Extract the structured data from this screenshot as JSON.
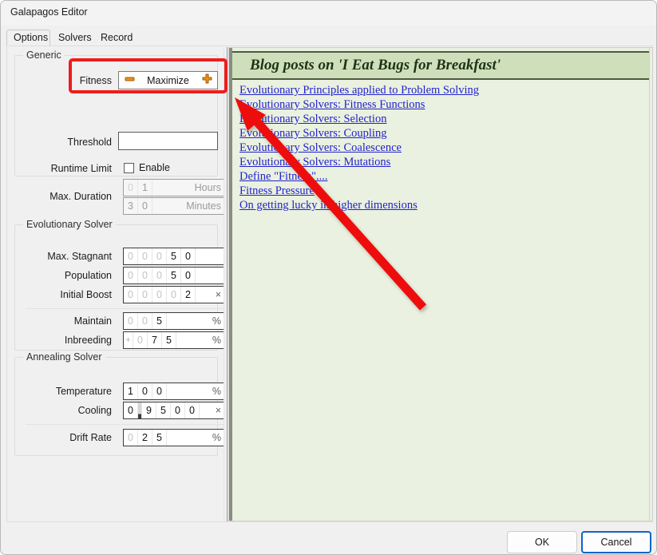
{
  "window": {
    "title": "Galapagos Editor"
  },
  "tabs": [
    {
      "label": "Options",
      "active": true
    },
    {
      "label": "Solvers",
      "active": false
    },
    {
      "label": "Record",
      "active": false
    }
  ],
  "options": {
    "generic": {
      "title": "Generic",
      "fitness": {
        "label": "Fitness",
        "value": "Maximize",
        "decrement_icon": "minus-icon",
        "increment_icon": "plus-icon"
      },
      "threshold": {
        "label": "Threshold",
        "value": ""
      },
      "runtime_limit": {
        "label": "Runtime Limit",
        "checkbox_label": "Enable",
        "checked": false
      },
      "max_duration": {
        "label": "Max. Duration",
        "hours": {
          "digits": [
            "0",
            "1"
          ],
          "leading": 1,
          "unit": "Hours",
          "disabled": true
        },
        "minutes": {
          "digits": [
            "3",
            "0"
          ],
          "leading": 0,
          "unit": "Minutes",
          "disabled": true
        }
      }
    },
    "evolutionary_solver": {
      "title": "Evolutionary Solver",
      "fields": [
        {
          "label": "Max. Stagnant",
          "digits": [
            "0",
            "0",
            "0",
            "5",
            "0"
          ],
          "leading": 3,
          "unit": ""
        },
        {
          "label": "Population",
          "digits": [
            "0",
            "0",
            "0",
            "5",
            "0"
          ],
          "leading": 3,
          "unit": ""
        },
        {
          "label": "Initial Boost",
          "digits": [
            "0",
            "0",
            "0",
            "0",
            "2"
          ],
          "leading": 4,
          "unit": "×"
        },
        {
          "label": "Maintain",
          "digits": [
            "0",
            "0",
            "5"
          ],
          "leading": 2,
          "unit": "%"
        },
        {
          "label": "Inbreeding",
          "sign": "+",
          "digits": [
            "0",
            "7",
            "5"
          ],
          "leading": 1,
          "unit": "%"
        }
      ]
    },
    "annealing_solver": {
      "title": "Annealing Solver",
      "fields": [
        {
          "label": "Temperature",
          "digits": [
            "1",
            "0",
            "0"
          ],
          "leading": 0,
          "unit": "%"
        },
        {
          "label": "Cooling",
          "digits": [
            "0",
            ".",
            "9",
            "5",
            "0",
            "0"
          ],
          "leading": 0,
          "unit": "×"
        },
        {
          "label": "Drift Rate",
          "digits": [
            "0",
            "2",
            "5"
          ],
          "leading": 1,
          "unit": "%"
        }
      ]
    }
  },
  "blog": {
    "header": "Blog posts on 'I Eat Bugs for Breakfast'",
    "links": [
      "Evolutionary Principles applied to Problem Solving",
      "Evolutionary Solvers: Fitness Functions",
      "Evolutionary Solvers: Selection",
      "Evolutionary Solvers: Coupling",
      "Evolutionary Solvers: Coalescence",
      "Evolutionary Solvers: Mutations",
      "Define \"Fitness\"....",
      "Fitness Pressure",
      "On getting lucky in higher dimensions"
    ]
  },
  "footer": {
    "ok_label": "OK",
    "cancel_label": "Cancel"
  },
  "annotation": {
    "highlight_color": "#ef1c1c",
    "arrow_color": "#ee1111"
  }
}
